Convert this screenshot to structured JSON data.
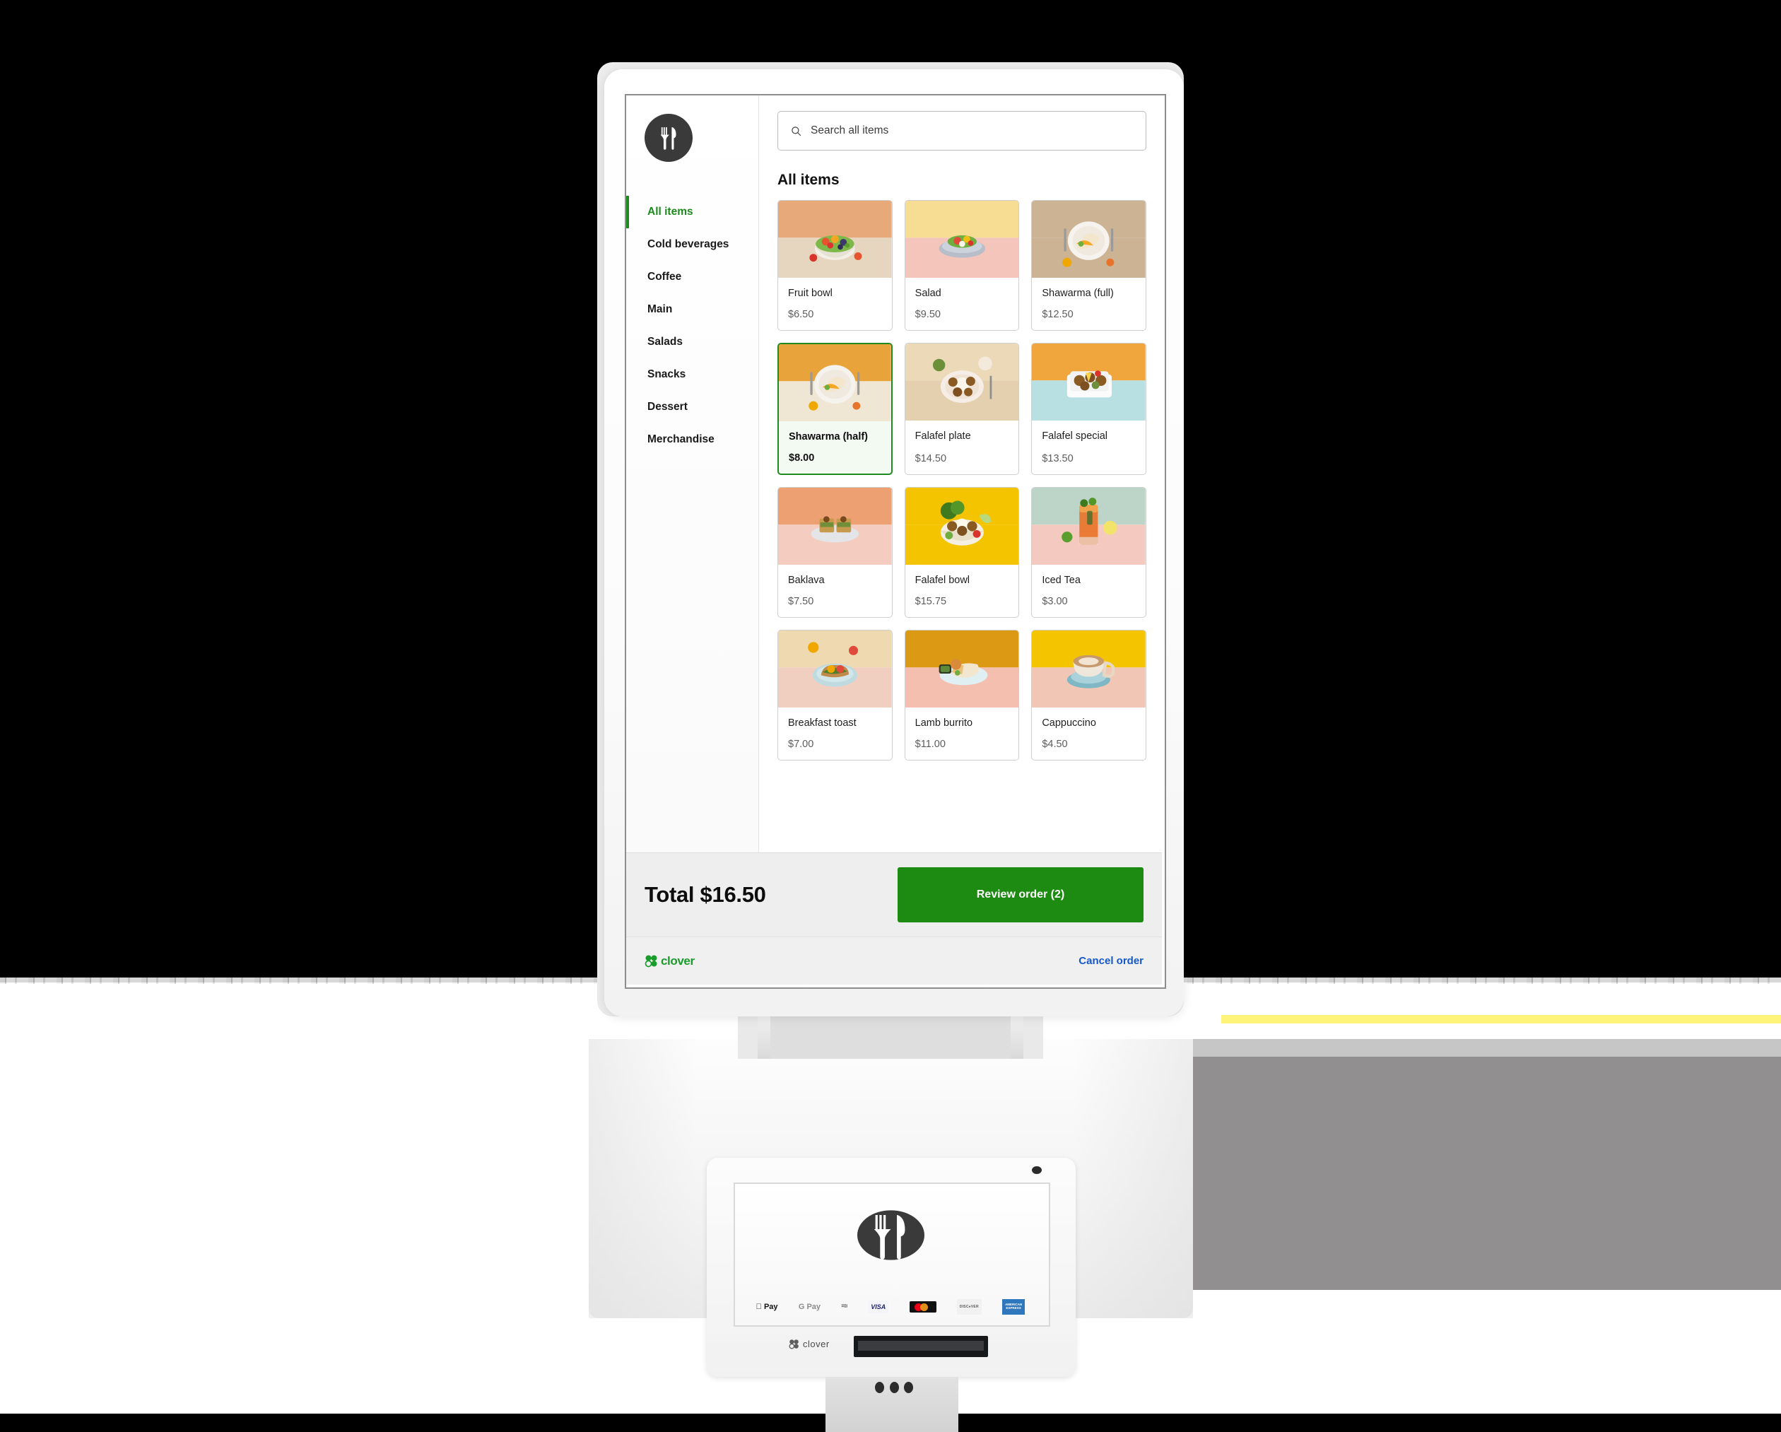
{
  "app": {
    "brand_icon": "fork-knife-icon",
    "search": {
      "placeholder": "Search all items",
      "icon": "search-icon"
    },
    "section_title": "All items",
    "sidebar": [
      {
        "label": "All items",
        "active": true
      },
      {
        "label": "Cold beverages",
        "active": false
      },
      {
        "label": "Coffee",
        "active": false
      },
      {
        "label": "Main",
        "active": false
      },
      {
        "label": "Salads",
        "active": false
      },
      {
        "label": "Snacks",
        "active": false
      },
      {
        "label": "Dessert",
        "active": false
      },
      {
        "label": "Merchandise",
        "active": false
      }
    ],
    "items": [
      {
        "name": "Fruit bowl",
        "price": "$6.50",
        "selected": false,
        "bg_top": "#e8a97a",
        "bg_bot": "#e6d6c0",
        "food": "bowl-salad"
      },
      {
        "name": "Salad",
        "price": "$9.50",
        "selected": false,
        "bg_top": "#f7dc94",
        "bg_bot": "#f4c6bb",
        "food": "plate-salad"
      },
      {
        "name": "Shawarma (full)",
        "price": "$12.50",
        "selected": false,
        "bg_top": "#cbb394",
        "bg_bot": "#cbb394",
        "food": "wrap-plate"
      },
      {
        "name": "Shawarma (half)",
        "price": "$8.00",
        "selected": true,
        "bg_top": "#e8a33a",
        "bg_bot": "#efe7d3",
        "food": "wrap-plate"
      },
      {
        "name": "Falafel plate",
        "price": "$14.50",
        "selected": false,
        "bg_top": "#ecd9b8",
        "bg_bot": "#e4cfae",
        "food": "falafel-plate"
      },
      {
        "name": "Falafel special",
        "price": "$13.50",
        "selected": false,
        "bg_top": "#f0a63c",
        "bg_bot": "#b8e0e3",
        "food": "falafel-box"
      },
      {
        "name": "Baklava",
        "price": "$7.50",
        "selected": false,
        "bg_top": "#eda173",
        "bg_bot": "#f5cdc0",
        "food": "baklava"
      },
      {
        "name": "Falafel bowl",
        "price": "$15.75",
        "selected": false,
        "bg_top": "#f5c400",
        "bg_bot": "#f5c400",
        "food": "falafel-bowl"
      },
      {
        "name": "Iced Tea",
        "price": "$3.00",
        "selected": false,
        "bg_top": "#bdd5c8",
        "bg_bot": "#f3c9c0",
        "food": "iced-tea"
      },
      {
        "name": "Breakfast toast",
        "price": "$7.00",
        "selected": false,
        "bg_top": "#efd9b0",
        "bg_bot": "#f0cfc0",
        "food": "toast"
      },
      {
        "name": "Lamb burrito",
        "price": "$11.00",
        "selected": false,
        "bg_top": "#dc9913",
        "bg_bot": "#f4bfae",
        "food": "burrito"
      },
      {
        "name": "Cappuccino",
        "price": "$4.50",
        "selected": false,
        "bg_top": "#f5c400",
        "bg_bot": "#f1c6b4",
        "food": "cappuccino"
      }
    ],
    "footer": {
      "total_label": "Total $16.50",
      "review_button": "Review order (2)",
      "clover_word": "clover",
      "cancel_link": "Cancel order"
    },
    "colors": {
      "accent_green": "#1f8a1f",
      "button_green": "#1d8a11",
      "clover_green": "#1a9c2c",
      "link_blue": "#1558c9",
      "selected_card_bg": "#f2faf1"
    }
  },
  "device": {
    "terminal": {
      "brand_word": "clover",
      "logo_icon": "fork-knife-icon",
      "payment_logos": [
        {
          "id": "apple-pay-logo",
          "label": "Pay"
        },
        {
          "id": "google-pay-logo",
          "label": "Pay"
        },
        {
          "id": "contactless-logo",
          "label": "CONTACTLESS"
        },
        {
          "id": "visa-logo",
          "label": "VISA"
        },
        {
          "id": "mastercard-logo",
          "label": ""
        },
        {
          "id": "discover-logo",
          "label": "DISCOVER"
        },
        {
          "id": "amex-logo",
          "label": "AMERICAN EXPRESS"
        }
      ]
    }
  }
}
